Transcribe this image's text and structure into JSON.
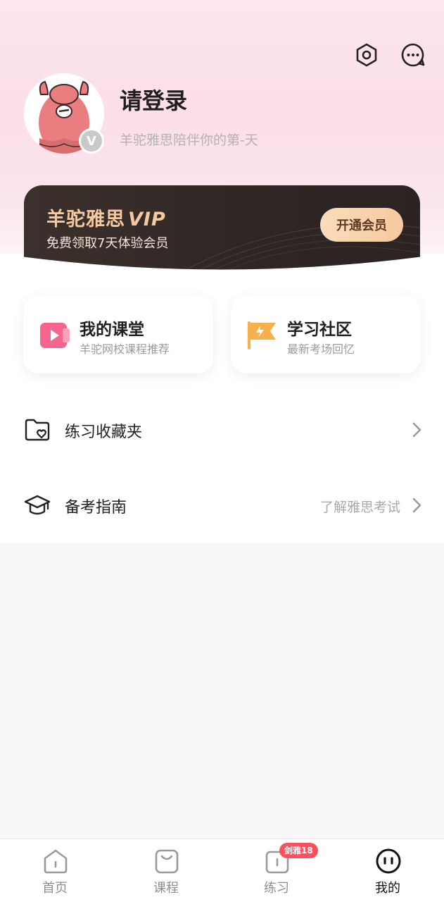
{
  "profile": {
    "title": "请登录",
    "subtitle": "羊驼雅思陪伴你的第-天",
    "badge": "V"
  },
  "vip": {
    "brand": "羊驼雅思",
    "vip_word": "VIP",
    "subtitle": "免费领取7天体验会员",
    "button": "开通会员"
  },
  "cards": [
    {
      "title": "我的课堂",
      "subtitle": "羊驼网校课程推荐",
      "icon": "video-icon"
    },
    {
      "title": "学习社区",
      "subtitle": "最新考场回忆",
      "icon": "flag-icon"
    }
  ],
  "rows": [
    {
      "label": "练习收藏夹",
      "hint": "",
      "icon": "folder-heart-icon"
    },
    {
      "label": "备考指南",
      "hint": "了解雅思考试",
      "icon": "graduation-cap-icon"
    }
  ],
  "tabs": [
    {
      "label": "首页",
      "icon": "home-icon",
      "active": false
    },
    {
      "label": "课程",
      "icon": "bag-icon",
      "active": false
    },
    {
      "label": "练习",
      "icon": "book-icon",
      "active": false,
      "badge": "剑雅18"
    },
    {
      "label": "我的",
      "icon": "face-icon",
      "active": true
    }
  ],
  "colors": {
    "accent_pink": "#f7648c",
    "accent_orange": "#f7b04a",
    "vip_gold": "#f5c9a0",
    "badge_red": "#ff4f5e"
  }
}
